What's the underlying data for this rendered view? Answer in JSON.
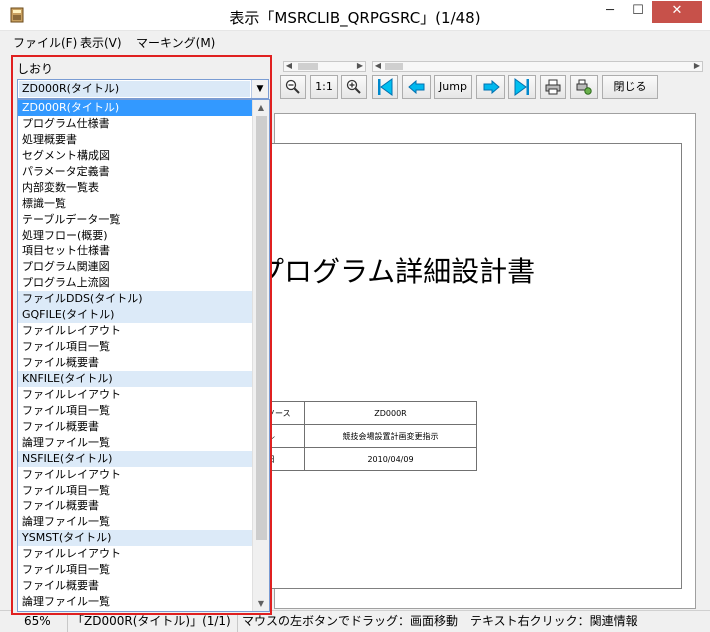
{
  "window": {
    "title": "表示「MSRCLIB_QRPGSRC」(1/48)",
    "minimize": "─",
    "maximize": "☐",
    "close": "✕"
  },
  "menu": [
    "ファイル(F)",
    "表示(V)",
    "マーキング(M)"
  ],
  "toolbar": {
    "zoom_ratio": "1:1",
    "jump": "Jump",
    "close": "閉じる"
  },
  "bookmarks": {
    "label": "しおり",
    "selected": "ZD000R(タイトル)",
    "items": [
      {
        "text": "ZD000R(タイトル)",
        "kind": "selected"
      },
      {
        "text": "プログラム仕様書",
        "kind": "normal"
      },
      {
        "text": "処理概要書",
        "kind": "normal"
      },
      {
        "text": "セグメント構成図",
        "kind": "normal"
      },
      {
        "text": "パラメータ定義書",
        "kind": "normal"
      },
      {
        "text": "内部変数一覧表",
        "kind": "normal"
      },
      {
        "text": "標識一覧",
        "kind": "normal"
      },
      {
        "text": "テーブルデータ一覧",
        "kind": "normal"
      },
      {
        "text": "処理フロー(概要)",
        "kind": "normal"
      },
      {
        "text": "項目セット仕様書",
        "kind": "normal"
      },
      {
        "text": "プログラム関連図",
        "kind": "normal"
      },
      {
        "text": "プログラム上流図",
        "kind": "normal"
      },
      {
        "text": "ファイルDDS(タイトル)",
        "kind": "title"
      },
      {
        "text": "GQFILE(タイトル)",
        "kind": "title"
      },
      {
        "text": "ファイルレイアウト",
        "kind": "normal"
      },
      {
        "text": "ファイル項目一覧",
        "kind": "normal"
      },
      {
        "text": "ファイル概要書",
        "kind": "normal"
      },
      {
        "text": "KNFILE(タイトル)",
        "kind": "title"
      },
      {
        "text": "ファイルレイアウト",
        "kind": "normal"
      },
      {
        "text": "ファイル項目一覧",
        "kind": "normal"
      },
      {
        "text": "ファイル概要書",
        "kind": "normal"
      },
      {
        "text": "論理ファイル一覧",
        "kind": "normal"
      },
      {
        "text": "NSFILE(タイトル)",
        "kind": "title"
      },
      {
        "text": "ファイルレイアウト",
        "kind": "normal"
      },
      {
        "text": "ファイル項目一覧",
        "kind": "normal"
      },
      {
        "text": "ファイル概要書",
        "kind": "normal"
      },
      {
        "text": "論理ファイル一覧",
        "kind": "normal"
      },
      {
        "text": "YSMST(タイトル)",
        "kind": "title"
      },
      {
        "text": "ファイルレイアウト",
        "kind": "normal"
      },
      {
        "text": "ファイル項目一覧",
        "kind": "normal"
      },
      {
        "text": "ファイル概要書",
        "kind": "normal"
      },
      {
        "text": "論理ファイル一覧",
        "kind": "normal"
      }
    ]
  },
  "document": {
    "title": "プログラム詳細設計書",
    "rows": [
      {
        "label": "ーソース",
        "value": "ZD000R"
      },
      {
        "label": "トル",
        "value": "競技会場設置計画変更指示"
      },
      {
        "label": "成日",
        "value": "2010/04/09"
      }
    ]
  },
  "status": {
    "zoom": "65%",
    "page": "「ZD000R(タイトル)」(1/1)",
    "hint": "マウスの左ボタンでドラッグ：画面移動　テキスト右クリック：関連情報"
  },
  "colors": {
    "highlight_border": "#e02020",
    "selected_row": "#3399ff",
    "title_row": "#dceaf8",
    "close_button": "#c7514a",
    "nav_arrow": "#00a0e0"
  }
}
